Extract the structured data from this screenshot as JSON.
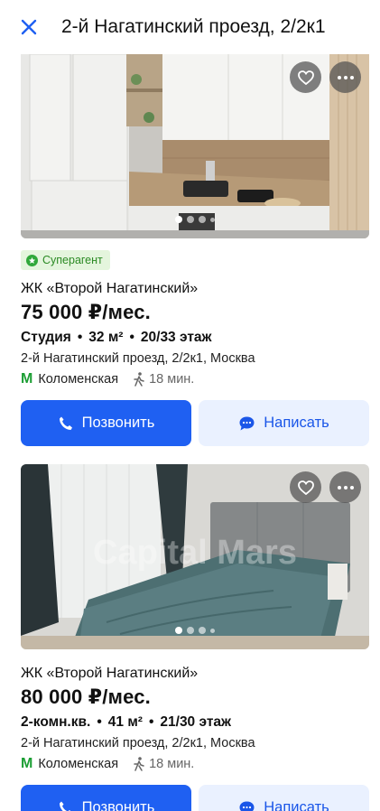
{
  "header": {
    "title": "2-й Нагатинский проезд, 2/2к1",
    "close_icon": "close-icon"
  },
  "colors": {
    "primary": "#1f60f2",
    "secondary_bg": "#eaf1ff",
    "metro": "#1c9e34",
    "badge_bg": "#e4f5dd"
  },
  "listings": [
    {
      "badge": "Суперагент",
      "complex": "ЖК «Второй Нагатинский»",
      "price": "75 000 ₽/мес.",
      "rooms": "Студия",
      "area": "32 м²",
      "floor": "20/33 этаж",
      "address": "2-й Нагатинский проезд, 2/2к1, Москва",
      "metro": "Коломенская",
      "walk": "18 мин.",
      "call_label": "Позвонить",
      "write_label": "Написать"
    },
    {
      "complex": "ЖК «Второй Нагатинский»",
      "price": "80 000 ₽/мес.",
      "rooms": "2-комн.кв.",
      "area": "41 м²",
      "floor": "21/30 этаж",
      "address": "2-й Нагатинский проезд, 2/2к1, Москва",
      "metro": "Коломенская",
      "walk": "18 мин.",
      "call_label": "Позвонить",
      "write_label": "Написать",
      "watermark": "Capital Mars"
    }
  ]
}
